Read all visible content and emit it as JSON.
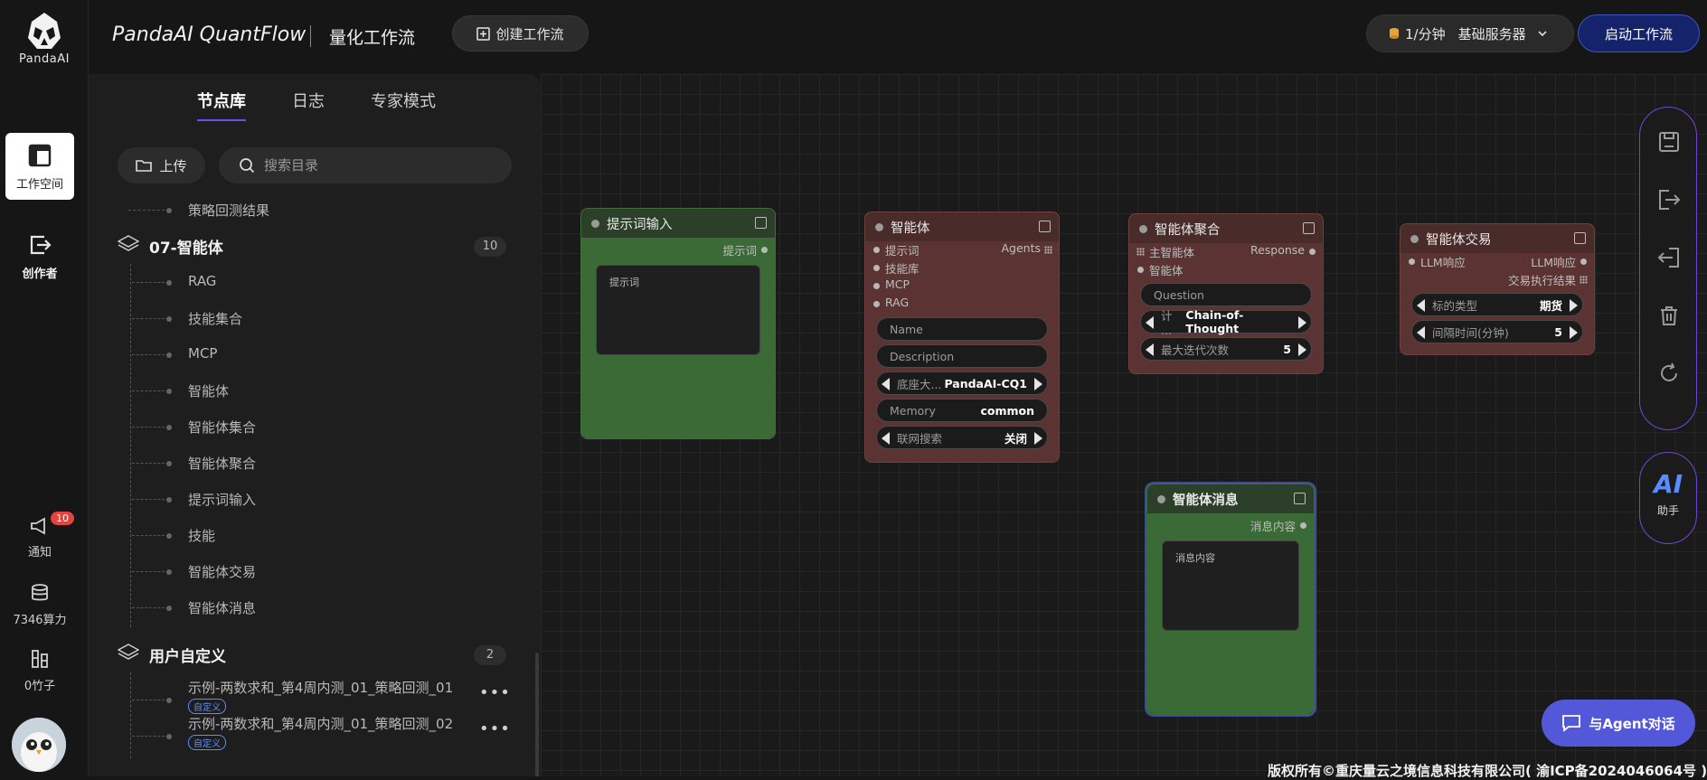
{
  "app": {
    "logo_text": "PandaAI",
    "brand": "PandaAI QuantFlow",
    "subtitle": "量化工作流"
  },
  "rail": {
    "workspace": "工作空间",
    "creator": "创作者",
    "notify": "通知",
    "notify_count": "10",
    "compute": "7346算力",
    "bamboo": "0竹子"
  },
  "topbar": {
    "create_label": "创建工作流",
    "rate": "1/分钟",
    "server": "基础服务器",
    "start_label": "启动工作流"
  },
  "panel": {
    "tabs": [
      "节点库",
      "日志",
      "专家模式"
    ],
    "upload_label": "上传",
    "search_placeholder": "搜索目录",
    "prev_leaf": "策略回测结果",
    "groups": [
      {
        "title": "07-智能体",
        "count": "10",
        "items": [
          "RAG",
          "技能集合",
          "MCP",
          "智能体",
          "智能体集合",
          "智能体聚合",
          "提示词输入",
          "技能",
          "智能体交易",
          "智能体消息"
        ]
      },
      {
        "title": "用户自定义",
        "count": "2",
        "items": [
          {
            "label": "示例-两数求和_第4周内测_01_策略回测_01",
            "tag": "自定义"
          },
          {
            "label": "示例-两数求和_第4周内测_01_策略回测_02",
            "tag": "自定义"
          }
        ]
      }
    ]
  },
  "nodes": {
    "prompt": {
      "title": "提示词输入",
      "out": "提示词",
      "text": "提示词"
    },
    "agent": {
      "title": "智能体",
      "inputs": [
        "提示词",
        "技能库",
        "MCP",
        "RAG"
      ],
      "out": "Agents",
      "name_ph": "Name",
      "desc_ph": "Description",
      "model_label": "底座大...",
      "model_val": "PandaAI-CQ1",
      "memory_label": "Memory",
      "memory_val": "common",
      "web_label": "联网搜索",
      "web_val": "关闭"
    },
    "agg": {
      "title": "智能体聚合",
      "in1": "主智能体",
      "in2": "智能体",
      "out": "Response",
      "question": "Question",
      "mode_label": "计 ...",
      "mode_val": "Chain-of-Thought",
      "iter_label": "最大迭代次数",
      "iter_val": "5"
    },
    "trade": {
      "title": "智能体交易",
      "in1": "LLM响应",
      "out1": "LLM响应",
      "out2": "交易执行结果",
      "type_label": "标的类型",
      "type_val": "期货",
      "interval_label": "间隔时间(分钟)",
      "interval_val": "5"
    },
    "msg": {
      "title": "智能体消息",
      "out": "消息内容",
      "text": "消息内容"
    }
  },
  "tools": {
    "ai_text": "AI",
    "ai_label": "助手",
    "chat_label": "与Agent对话"
  },
  "footer": "版权所有©重庆量云之境信息科技有限公司( 渝ICP备2024046064号 )",
  "colors": {
    "accent": "#6c4cf6",
    "start_btn": "#15246a",
    "chat_btn": "#5358d8",
    "green_node": "#3a6a35",
    "red_node": "#5a3332"
  }
}
